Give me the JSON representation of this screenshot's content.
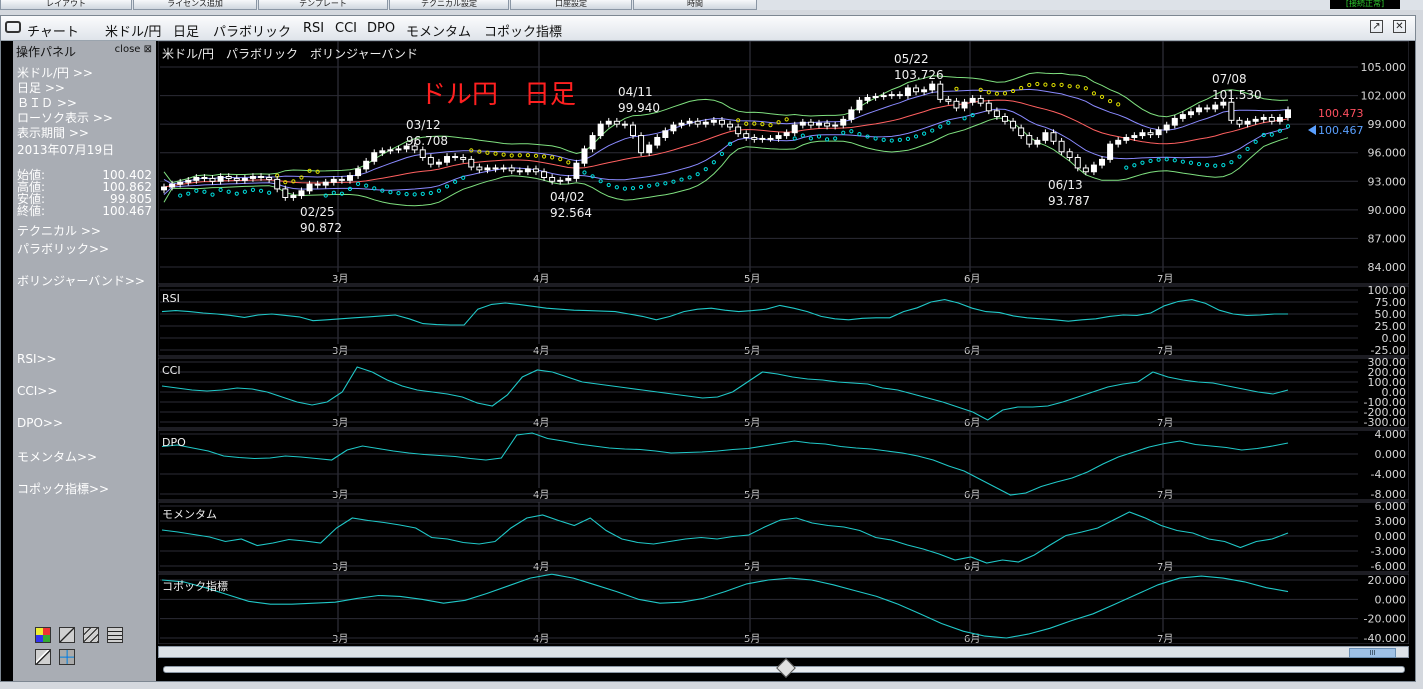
{
  "top_tabs": [
    "レイアウト",
    "ライセンス追加",
    "テンプレート",
    "テクニカル設定",
    "口座設定",
    "時間"
  ],
  "connection_status": "[接続正常]",
  "menu": {
    "items": [
      "チャート",
      "米ドル/円",
      "日足",
      "パラボリック",
      "RSI",
      "CCI",
      "DPO",
      "モメンタム",
      "コポック指標"
    ]
  },
  "panel": {
    "title": "操作パネル",
    "close": "close",
    "symbol": "米ドル/円 >>",
    "timeframe": "日足 >>",
    "bid": "ＢＩＤ >>",
    "candle": "ローソク表示 >>",
    "period_label": "表示期間 >>",
    "date": "2013年07月19日",
    "ohlc": [
      {
        "label": "始値:",
        "value": "100.402"
      },
      {
        "label": "高値:",
        "value": "100.862"
      },
      {
        "label": "安値:",
        "value": "99.805"
      },
      {
        "label": "終値:",
        "value": "100.467"
      }
    ],
    "technical": "テクニカル >>",
    "parabolic": "パラボリック>>",
    "bollinger": "ボリンジャーバンド>>",
    "rsi": "RSI>>",
    "cci": "CCI>>",
    "dpo": "DPO>>",
    "momentum": "モメンタム>>",
    "coppock": "コポック指標>>"
  },
  "colors": {
    "background": "#000000",
    "candle_up": "#ffffff",
    "sar": "#00dddd",
    "sar_upper": "#dddd00",
    "bb_outer": "#7fe07f",
    "bb_mid": "#ff6060",
    "bb_inner": "#8a8aff",
    "indicator": "#20c8c8",
    "title_red": "#ff2020",
    "price_red": "#ff5060",
    "price_blue": "#5aa0ff"
  },
  "chart_data": [
    {
      "type": "candlestick",
      "title": "ドル円　日足",
      "subtitle": "米ドル/円　パラボリック　ボリンジャーバンド",
      "month_labels": [
        "3月",
        "4月",
        "5月",
        "6月",
        "7月"
      ],
      "y_ticks": [
        "105.000",
        "102.000",
        "99.000",
        "96.000",
        "93.000",
        "90.000",
        "87.000",
        "84.000"
      ],
      "ylim": [
        84,
        105
      ],
      "annotations": [
        {
          "date": "02/25",
          "value": "90.872"
        },
        {
          "date": "03/12",
          "value": "96.708"
        },
        {
          "date": "04/02",
          "value": "92.564"
        },
        {
          "date": "04/11",
          "value": "99.940"
        },
        {
          "date": "05/22",
          "value": "103.726"
        },
        {
          "date": "06/13",
          "value": "93.787"
        },
        {
          "date": "07/08",
          "value": "101.530"
        }
      ],
      "price_red": "100.473",
      "price_blue": "100.467",
      "closes": [
        92.4,
        92.7,
        92.9,
        93.1,
        93.4,
        93.3,
        93.0,
        93.5,
        93.3,
        93.1,
        93.3,
        93.5,
        93.4,
        93.2,
        92.2,
        91.3,
        91.5,
        92.0,
        92.7,
        92.6,
        92.9,
        93.2,
        93.1,
        93.6,
        94.3,
        95.1,
        96.0,
        96.2,
        96.3,
        96.4,
        96.7,
        96.3,
        95.5,
        94.8,
        95.0,
        95.6,
        95.5,
        95.3,
        94.5,
        94.2,
        94.4,
        94.3,
        94.4,
        94.1,
        94.0,
        94.3,
        94.0,
        93.4,
        93.0,
        93.1,
        93.3,
        94.9,
        96.4,
        97.8,
        99.0,
        99.3,
        99.0,
        98.9,
        97.8,
        96.0,
        96.8,
        97.6,
        98.3,
        98.9,
        99.1,
        99.3,
        99.0,
        99.2,
        99.4,
        99.0,
        98.7,
        98.0,
        97.6,
        97.4,
        97.5,
        97.5,
        97.8,
        98.1,
        98.9,
        99.2,
        98.9,
        99.1,
        98.8,
        98.9,
        99.5,
        100.5,
        101.5,
        101.8,
        101.9,
        102.0,
        102.1,
        102.0,
        102.8,
        102.4,
        102.6,
        103.2,
        101.6,
        101.4,
        100.7,
        101.3,
        101.7,
        101.2,
        100.4,
        99.8,
        99.3,
        98.6,
        97.8,
        96.9,
        97.3,
        98.1,
        97.2,
        96.1,
        95.5,
        94.4,
        94.0,
        94.7,
        95.3,
        96.9,
        97.3,
        97.6,
        97.8,
        98.1,
        97.9,
        98.4,
        98.9,
        99.6,
        100.0,
        100.3,
        100.7,
        100.6,
        101.0,
        101.3,
        99.4,
        99.0,
        99.3,
        99.5,
        99.7,
        99.3,
        99.7,
        100.5
      ],
      "x_axis_month_indices": [
        29,
        65,
        101,
        140,
        174
      ]
    },
    {
      "type": "line",
      "title": "RSI",
      "y_ticks": [
        "100.00",
        "75.00",
        "50.00",
        "25.00",
        "0.00",
        "-25.00"
      ],
      "ylim": [
        -25,
        100
      ],
      "values": [
        55,
        57,
        55,
        52,
        50,
        47,
        43,
        48,
        50,
        47,
        44,
        36,
        38,
        40,
        42,
        44,
        46,
        48,
        40,
        30,
        28,
        27,
        27,
        60,
        70,
        73,
        70,
        66,
        62,
        60,
        58,
        57,
        56,
        55,
        50,
        45,
        38,
        45,
        55,
        60,
        62,
        58,
        55,
        57,
        60,
        68,
        62,
        55,
        45,
        40,
        38,
        41,
        42,
        42,
        55,
        63,
        75,
        80,
        73,
        62,
        55,
        53,
        46,
        42,
        40,
        38,
        35,
        38,
        40,
        45,
        48,
        47,
        52,
        67,
        76,
        80,
        72,
        58,
        50,
        47,
        48,
        50,
        50
      ]
    },
    {
      "type": "line",
      "title": "CCI",
      "y_ticks": [
        "300.00",
        "200.00",
        "100.00",
        "0.00",
        "-100.00",
        "-200.00",
        "-300.00"
      ],
      "ylim": [
        -300,
        300
      ],
      "values": [
        60,
        40,
        20,
        10,
        20,
        40,
        30,
        0,
        -50,
        -100,
        -130,
        -100,
        0,
        250,
        200,
        120,
        60,
        20,
        0,
        -20,
        -50,
        -110,
        -140,
        -30,
        150,
        220,
        200,
        150,
        100,
        80,
        60,
        40,
        20,
        0,
        -20,
        -40,
        -60,
        -50,
        0,
        100,
        200,
        180,
        150,
        130,
        120,
        100,
        90,
        80,
        40,
        20,
        -20,
        -60,
        -100,
        -150,
        -200,
        -280,
        -180,
        -150,
        -150,
        -140,
        -100,
        -50,
        0,
        50,
        80,
        100,
        200,
        150,
        120,
        100,
        90,
        60,
        30,
        0,
        -20,
        20
      ]
    },
    {
      "type": "line",
      "title": "DPO",
      "y_ticks": [
        "4.000",
        "0.000",
        "-4.000",
        "-8.000"
      ],
      "ylim": [
        -9.5,
        5.5
      ],
      "values": [
        1.5,
        1.8,
        1.2,
        0.6,
        -0.4,
        -0.7,
        -0.9,
        -0.8,
        -0.4,
        -0.6,
        -0.9,
        -1.2,
        0.8,
        1.6,
        1.1,
        0.6,
        0.2,
        -0.1,
        -0.3,
        -0.5,
        -0.9,
        -1.2,
        -0.8,
        3.8,
        4.2,
        3.1,
        2.6,
        2.0,
        1.6,
        1.2,
        1.0,
        0.9,
        0.6,
        0.2,
        0.3,
        0.4,
        0.6,
        0.9,
        1.1,
        1.6,
        2.1,
        2.6,
        2.2,
        2.0,
        1.5,
        1.2,
        1.0,
        0.6,
        0.2,
        -0.4,
        -1.2,
        -2.4,
        -3.4,
        -5.0,
        -6.6,
        -8.2,
        -7.8,
        -6.5,
        -5.6,
        -4.8,
        -3.6,
        -2.0,
        -0.6,
        0.4,
        1.4,
        2.1,
        2.6,
        1.9,
        1.6,
        1.3,
        0.8,
        1.1,
        1.6,
        2.2
      ]
    },
    {
      "type": "line",
      "title": "モメンタム",
      "y_ticks": [
        "6.000",
        "3.000",
        "0.000",
        "-3.000",
        "-6.000"
      ],
      "ylim": [
        -6.5,
        6.5
      ],
      "values": [
        1.2,
        0.8,
        0.3,
        -0.2,
        -1.1,
        -0.6,
        -1.9,
        -1.4,
        -0.7,
        -1.0,
        -1.4,
        1.6,
        3.6,
        3.1,
        2.7,
        2.2,
        1.6,
        -0.3,
        -0.6,
        -1.3,
        -1.6,
        -1.1,
        1.6,
        3.6,
        4.2,
        3.1,
        2.1,
        3.6,
        1.1,
        -0.6,
        -1.3,
        -1.6,
        -1.1,
        -0.6,
        -0.3,
        -0.6,
        -0.1,
        0.2,
        1.8,
        3.2,
        3.6,
        2.6,
        2.1,
        1.8,
        1.1,
        -0.3,
        -0.8,
        -1.8,
        -2.6,
        -3.6,
        -4.8,
        -4.2,
        -5.4,
        -4.8,
        -5.2,
        -3.8,
        -1.8,
        0.1,
        0.8,
        1.6,
        3.2,
        4.8,
        3.6,
        2.1,
        1.1,
        0.6,
        -0.6,
        -1.1,
        -2.3,
        -1.1,
        -0.6,
        0.6
      ]
    },
    {
      "type": "line",
      "title": "コポック指標",
      "y_ticks": [
        "20.000",
        "0.000",
        "-20.000",
        "-40.000"
      ],
      "ylim": [
        -45,
        30
      ],
      "values": [
        20,
        18,
        12,
        5,
        -2,
        -5,
        -5,
        -4,
        -3,
        1,
        4,
        3,
        0,
        -4,
        -1,
        6,
        14,
        22,
        26,
        22,
        15,
        8,
        0,
        -4,
        -3,
        1,
        8,
        16,
        20,
        22,
        20,
        15,
        9,
        3,
        -5,
        -15,
        -25,
        -33,
        -38,
        -40,
        -36,
        -30,
        -22,
        -15,
        -5,
        5,
        15,
        22,
        24,
        22,
        18,
        12,
        8
      ]
    }
  ]
}
